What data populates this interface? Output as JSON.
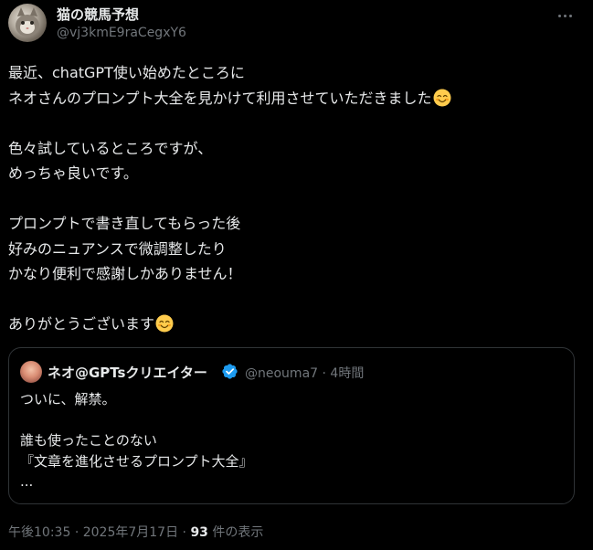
{
  "author": {
    "display_name": "猫の競馬予想",
    "handle": "@vj3kmE9raCegxY6"
  },
  "tweet": {
    "paragraph1": [
      "最近、chatGPT使い始めたところに",
      "ネオさんのプロンプト大全を見かけて利用させていただきました"
    ],
    "paragraph2": [
      "色々試しているところですが、",
      "めっちゃ良いです。"
    ],
    "paragraph3": [
      "プロンプトで書き直してもらった後",
      "好みのニュアンスで微調整したり",
      "かなり便利で感謝しかありません！"
    ],
    "paragraph4": [
      "ありがとうございます"
    ],
    "emoji": "smiling-face-icon"
  },
  "quote": {
    "display_name": "ネオ@GPTsクリエイター",
    "handle": "@neouma7",
    "separator": "·",
    "time": "4時間",
    "text_lines": [
      "ついに、解禁。",
      "",
      "誰も使ったことのない",
      "『文章を進化させるプロンプト大全』",
      "..."
    ]
  },
  "footer": {
    "time": "午後10:35",
    "separator1": "·",
    "date": "2025年7月17日",
    "separator2": "·",
    "views_count": "93",
    "views_label": "件の表示"
  },
  "colors": {
    "background": "#000000",
    "text": "#e7e9ea",
    "muted": "#71767b",
    "border": "#2f3336",
    "verified": "#1d9bf0"
  }
}
